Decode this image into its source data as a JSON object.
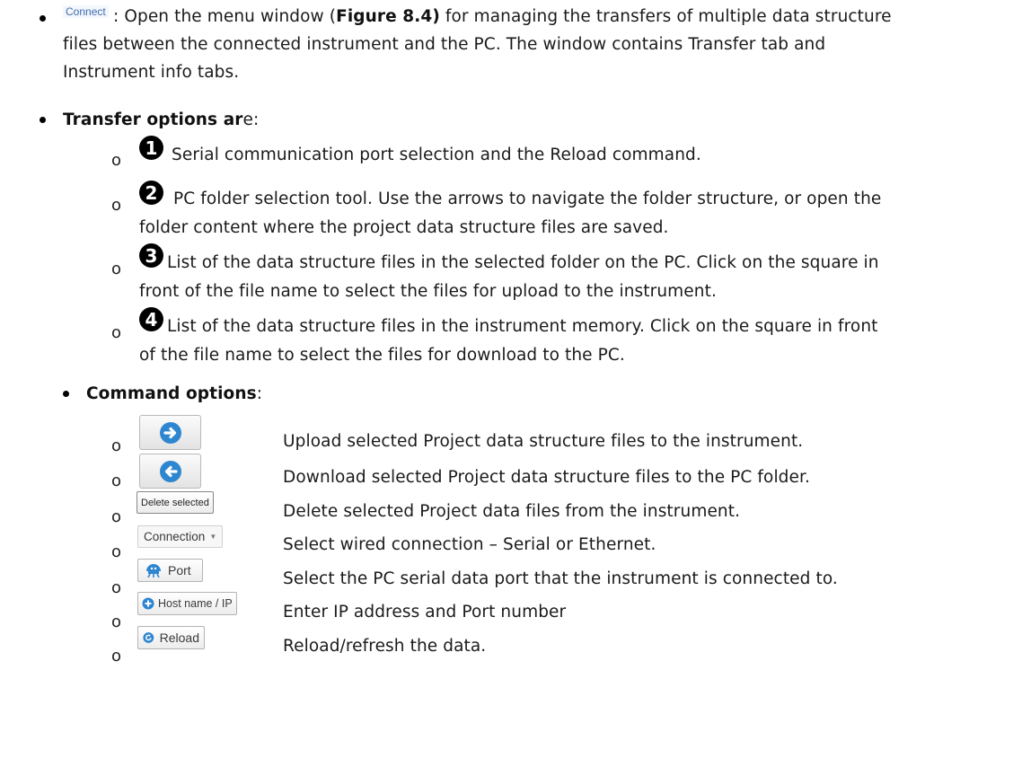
{
  "connect_label": "Connect",
  "intro": {
    "text_part1": ": Open the menu window (",
    "figure_ref": "Figure 8.4)",
    "text_part2": " for managing the transfers of multiple data structure",
    "line2": "files between the connected instrument and the PC. The window contains Transfer tab and",
    "line3": "Instrument info tabs."
  },
  "transfer": {
    "heading": "Transfer options ar",
    "heading_rest": "e:",
    "items": [
      {
        "number": "1",
        "lines": [
          "Serial communication port selection and the Reload command."
        ]
      },
      {
        "number": "2",
        "lines": [
          "PC folder selection tool. Use the arrows to navigate the folder structure, or open the",
          "folder content where the project data structure files are saved."
        ]
      },
      {
        "number": "3",
        "lines": [
          "List of the data structure files in the selected folder on the PC. Click on the square in",
          "front of the file name to select the files for upload to the instrument."
        ]
      },
      {
        "number": "4",
        "lines": [
          "List of the data structure files in the instrument memory. Click on the square in front",
          "of the file name to select the files for download to the PC."
        ]
      }
    ]
  },
  "command": {
    "heading": "Command options",
    "heading_colon": ":",
    "items": [
      {
        "button_icon": "arrow-right-circle-icon",
        "description": "Upload selected Project data structure files to the instrument."
      },
      {
        "button_icon": "arrow-left-circle-icon",
        "description": "Download selected Project data structure files to the PC folder."
      },
      {
        "button_label": "Delete selected",
        "description": "Delete selected Project data files from the instrument."
      },
      {
        "button_label": "Connection",
        "button_icon": "caret-down-icon",
        "description": "Select wired connection – Serial or Ethernet."
      },
      {
        "button_label": "Port",
        "button_icon": "port-icon",
        "description": "Select the PC serial data port that the instrument is connected to."
      },
      {
        "button_label": "Host name / IP",
        "button_icon": "plus-circle-icon",
        "description": "Enter IP address and Port number"
      },
      {
        "button_label": "Reload",
        "button_icon": "reload-icon",
        "description": "Reload/refresh the data."
      }
    ]
  },
  "colors": {
    "icon_blue": "#2f86d0",
    "link_blue": "#3f6fb0"
  }
}
